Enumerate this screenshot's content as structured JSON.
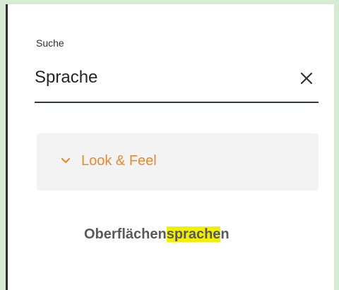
{
  "search": {
    "label": "Suche",
    "value": "Sprache"
  },
  "results": {
    "group": {
      "title": "Look & Feel",
      "icon": "chevron-down-icon"
    },
    "item": {
      "before": "Oberflächen",
      "highlight": "sprache",
      "after": "n"
    }
  },
  "icons": {
    "clear": "close-icon",
    "chevron": "chevron-down-icon"
  },
  "colors": {
    "background": "#d7ebd3",
    "panel": "#ffffff",
    "accent": "#e58b2d",
    "highlight": "#f3ef00",
    "text": "#595959"
  }
}
